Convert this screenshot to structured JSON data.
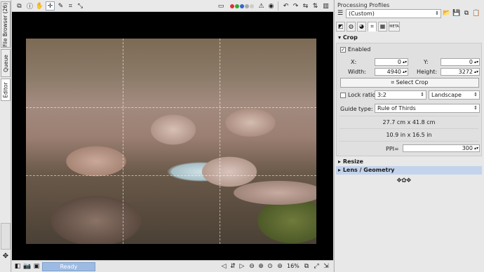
{
  "left_tabs": {
    "file_browser": "File Browser (26)",
    "queue": "Queue",
    "editor": "Editor"
  },
  "toolbar": {
    "icons": [
      "copy-icon",
      "info-icon",
      "hand-icon",
      "crosshair-icon",
      "picker-icon",
      "crop-icon",
      "transform-icon",
      "before-after-icon",
      "channel-dots-icon",
      "warning-icon",
      "focus-mask-icon",
      "rotate-left-icon",
      "rotate-right-icon",
      "flip-icon",
      "flip-vertical-icon",
      "panel-icon"
    ]
  },
  "statusbar": {
    "status": "Ready",
    "zoom": "16%"
  },
  "profiles": {
    "title": "Processing Profiles",
    "selected": "(Custom)"
  },
  "crop": {
    "header": "Crop",
    "enabled_label": "Enabled",
    "enabled": true,
    "x_label": "X:",
    "x_value": "0",
    "y_label": "Y:",
    "y_value": "0",
    "width_label": "Width:",
    "width_value": "4940",
    "height_label": "Height:",
    "height_value": "3272",
    "select_crop": "Select Crop",
    "lock_ratio_label": "Lock ratio",
    "lock_ratio": false,
    "ratio_value": "3:2",
    "orientation_value": "Landscape",
    "guide_type_label": "Guide type:",
    "guide_type_value": "Rule of Thirds",
    "size_cm": "27.7 cm x 41.8 cm",
    "size_in": "10.9 in x 16.5 in",
    "ppi_label": "PPI=",
    "ppi_value": "300"
  },
  "sections": {
    "resize": "Resize",
    "lens": "Lens / Geometry"
  },
  "colors": {
    "accent": "#9dbbe2",
    "selected_section": "#c3d3ec",
    "viewport_bg": "#000000"
  }
}
